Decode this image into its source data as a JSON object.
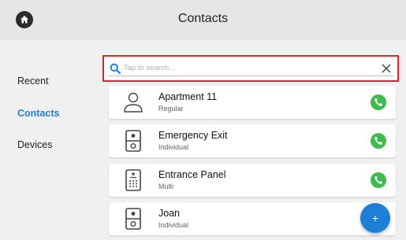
{
  "header": {
    "title": "Contacts",
    "home_icon": "home-icon"
  },
  "sidebar": {
    "items": [
      {
        "label": "Recent",
        "active": false
      },
      {
        "label": "Contacts",
        "active": true
      },
      {
        "label": "Devices",
        "active": false
      }
    ]
  },
  "search": {
    "placeholder": "Tap to search...",
    "value": "",
    "search_icon": "search-icon",
    "clear_icon": "close-icon"
  },
  "contacts": [
    {
      "name": "Apartment 11",
      "type": "Regular",
      "icon": "person-icon"
    },
    {
      "name": "Emergency Exit",
      "type": "Individual",
      "icon": "intercom-icon"
    },
    {
      "name": "Entrance Panel",
      "type": "Multi",
      "icon": "keypad-intercom-icon"
    },
    {
      "name": "Joan",
      "type": "Individual",
      "icon": "intercom-icon"
    }
  ],
  "fab": {
    "label": "+"
  },
  "colors": {
    "accent": "#1e7fd6",
    "call": "#3dbb4f",
    "highlight": "#e0212b"
  }
}
